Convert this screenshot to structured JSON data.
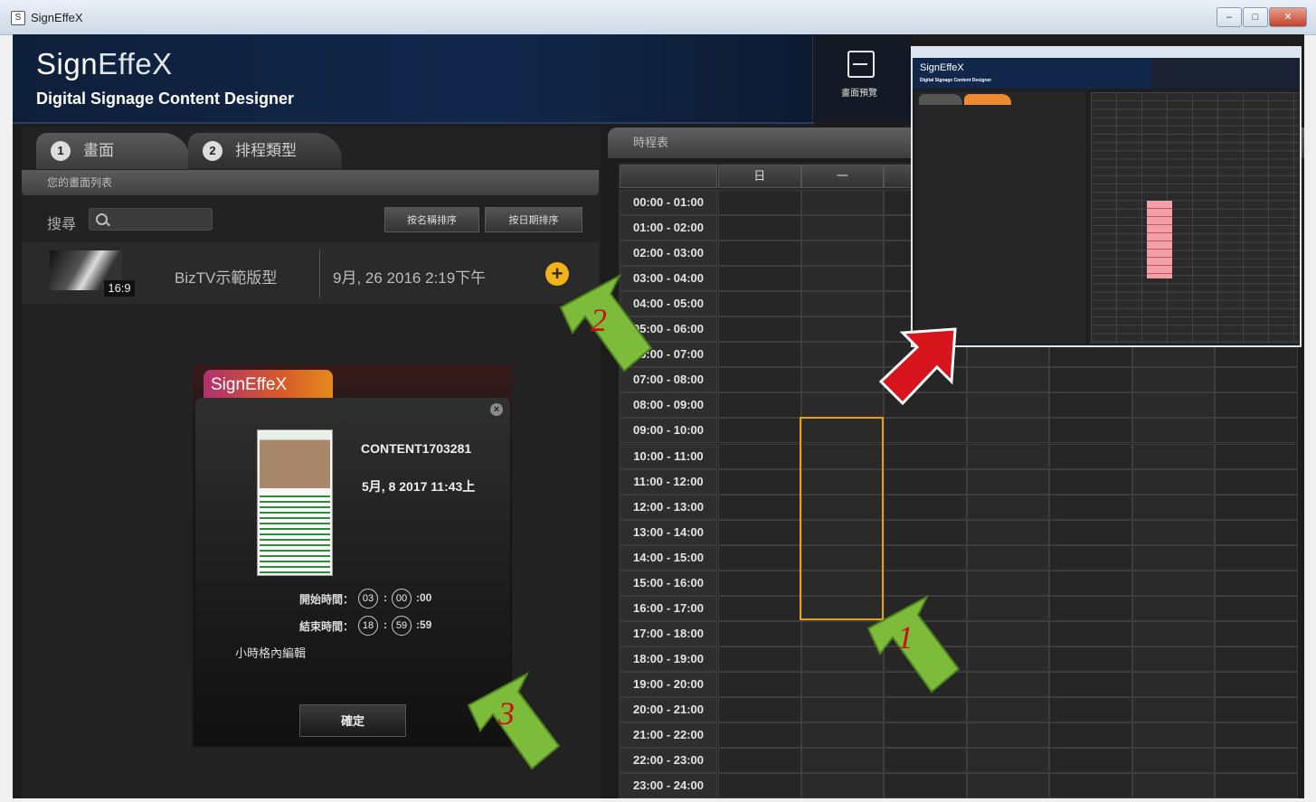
{
  "window": {
    "title": "SignEffeX",
    "app_icon": "S"
  },
  "header": {
    "logo_bold": "Sign",
    "logo_light": "EffeX",
    "subtitle": "Digital Signage Content Designer",
    "preview_label": "畫面預覽"
  },
  "tabs": [
    {
      "num": "1",
      "label": "畫面"
    },
    {
      "num": "2",
      "label": "排程類型"
    }
  ],
  "list": {
    "header": "您的畫面列表",
    "search_label": "搜尋",
    "search_placeholder": "",
    "sort_by_name": "按名稱排序",
    "sort_by_date": "按日期排序",
    "items": [
      {
        "name": "BizTV示範版型",
        "date": "9月, 26 2016 2:19下午",
        "aspect": "16:9"
      }
    ]
  },
  "dialog": {
    "logo": "SignEffeX",
    "content_name": "CONTENT1703281",
    "content_date": "5月, 8 2017 11:43上",
    "start_label": "開始時間：",
    "start_hour": "03",
    "start_min": "00",
    "start_sec": ":00",
    "end_label": "結束時間：",
    "end_hour": "18",
    "end_min": "59",
    "end_sec": ":59",
    "hint": "小時格內編輯",
    "ok": "確定"
  },
  "schedule": {
    "header": "時程表",
    "days": [
      "日",
      "一",
      ""
    ],
    "times": [
      "00:00 - 01:00",
      "01:00 - 02:00",
      "02:00 - 03:00",
      "03:00 - 04:00",
      "04:00 - 05:00",
      "05:00 - 06:00",
      "06:00 - 07:00",
      "07:00 - 08:00",
      "08:00 - 09:00",
      "09:00 - 10:00",
      "10:00 - 11:00",
      "11:00 - 12:00",
      "12:00 - 13:00",
      "13:00 - 14:00",
      "14:00 - 15:00",
      "15:00 - 16:00",
      "16:00 - 17:00",
      "17:00 - 18:00",
      "18:00 - 19:00",
      "19:00 - 20:00",
      "20:00 - 21:00",
      "21:00 - 22:00",
      "22:00 - 23:00",
      "23:00 - 24:00"
    ]
  },
  "inset": {
    "logo": "SignEffeX"
  },
  "annotations": [
    {
      "label": "1",
      "color": "#7cbc3a"
    },
    {
      "label": "2",
      "color": "#7cbc3a"
    },
    {
      "label": "3",
      "color": "#7cbc3a"
    },
    {
      "label": "",
      "color": "#d8141c"
    }
  ]
}
